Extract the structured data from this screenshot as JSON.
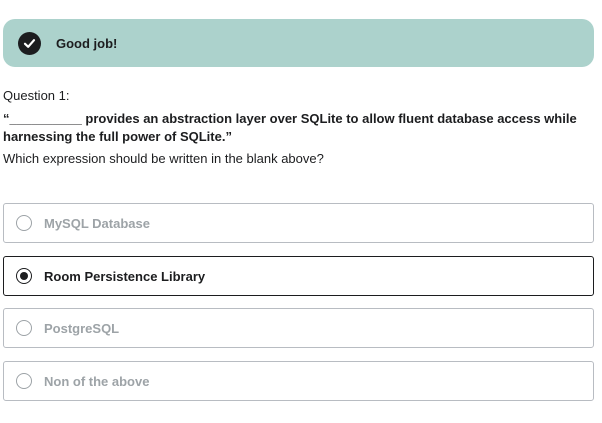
{
  "feedback": {
    "icon": "check-circle-icon",
    "message": "Good job!",
    "color": "#acd2cc"
  },
  "question": {
    "label": "Question 1:",
    "text": "“__________ provides an abstraction layer over SQLite to allow fluent database access while harnessing the full power of SQLite.”",
    "prompt": "Which expression should be written in the blank above?"
  },
  "options": [
    {
      "label": "MySQL Database",
      "selected": false
    },
    {
      "label": "Room Persistence Library",
      "selected": true
    },
    {
      "label": "PostgreSQL",
      "selected": false
    },
    {
      "label": "Non of the above",
      "selected": false
    }
  ]
}
